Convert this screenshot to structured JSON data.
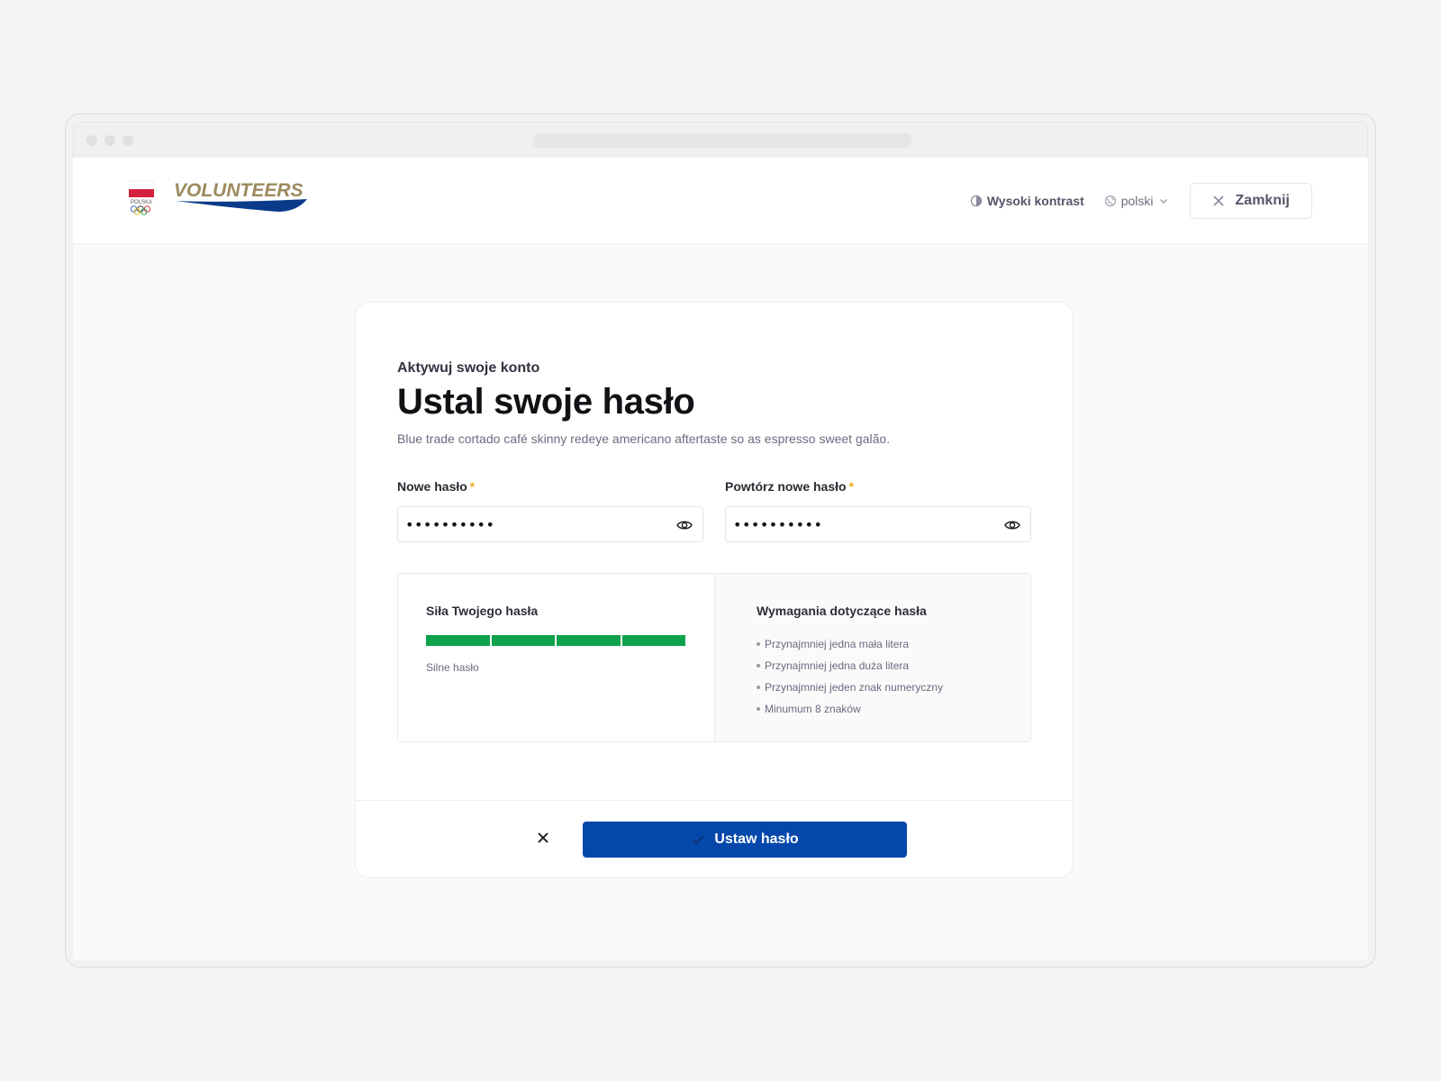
{
  "header": {
    "logo_text": "VOLUNTEERS",
    "logo_badge_text": "POLSKA",
    "high_contrast_label": "Wysoki kontrast",
    "language_label": "polski",
    "close_label": "Zamknij"
  },
  "form": {
    "eyebrow": "Aktywuj swoje konto",
    "title": "Ustal swoje hasło",
    "description": "Blue trade cortado café skinny redeye americano aftertaste so as espresso sweet galão.",
    "required_mark": "*",
    "new_password": {
      "label": "Nowe hasło",
      "value": "••••••••••"
    },
    "repeat_password": {
      "label": "Powtórz nowe hasło",
      "value": "••••••••••"
    },
    "strength": {
      "title": "Siła Twojego hasła",
      "filled_segments": 4,
      "total_segments": 4,
      "label": "Silne hasło"
    },
    "requirements": {
      "title": "Wymagania dotyczące hasła",
      "items": [
        "Przynajmniej jedna mała litera",
        "Przynajmniej jedna duża litera",
        "Przynajmniej jeden znak numeryczny",
        "Minumum 8 znaków"
      ]
    },
    "submit_label": "Ustaw hasło"
  },
  "colors": {
    "primary": "#0547ab",
    "strength_on": "#0ea24c",
    "required": "#f0a818",
    "logo_gold": "#9c8a5e",
    "logo_blue": "#0a3a8a"
  },
  "icons": {
    "contrast": "contrast-icon",
    "language": "globe-icon",
    "close": "close-icon",
    "eye": "eye-icon",
    "check": "check-icon"
  }
}
